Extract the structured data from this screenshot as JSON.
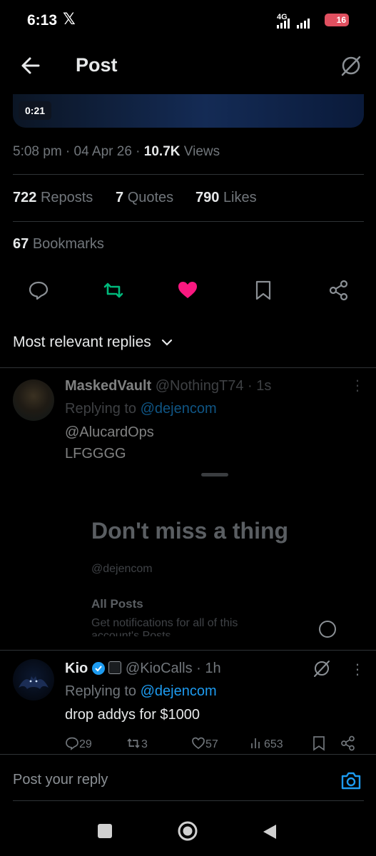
{
  "status_bar": {
    "time": "6:13",
    "network": "4G",
    "battery": "16"
  },
  "header": {
    "title": "Post"
  },
  "video": {
    "duration": "0:21"
  },
  "post_meta": {
    "time": "5:08 pm",
    "date": "04 Apr 26",
    "views_count": "10.7K",
    "views_label": "Views"
  },
  "stats": {
    "reposts_count": "722",
    "reposts_label": "Reposts",
    "quotes_count": "7",
    "quotes_label": "Quotes",
    "likes_count": "790",
    "likes_label": "Likes",
    "bookmarks_count": "67",
    "bookmarks_label": "Bookmarks"
  },
  "actions": [
    "reply-icon",
    "repost-icon",
    "like-icon",
    "bookmark-icon",
    "share-icon"
  ],
  "replies_filter": {
    "label": "Most relevant replies"
  },
  "reply1": {
    "name": "MaskedVault",
    "handle": "@NothingT74",
    "time": "1s",
    "replying_prefix": "Replying to",
    "replying_to": "@dejencom",
    "line1": "@AlucardOps",
    "line2": "LFGGGG"
  },
  "notify_sheet": {
    "title": "Don't miss a thing",
    "handle": "@dejencom",
    "option_title": "All Posts",
    "option_desc": "Get notifications for all of this",
    "option_desc_cut": "account's Posts"
  },
  "reply2": {
    "name": "Kio",
    "handle": "@KioCalls",
    "time": "1h",
    "replying_prefix": "Replying to",
    "replying_to": "@dejencom",
    "text": "drop addys for $1000",
    "replies": "29",
    "reposts": "3",
    "likes": "57",
    "views": "653"
  },
  "composer": {
    "placeholder": "Post your reply"
  },
  "colors": {
    "accent": "#1d9bf0",
    "like": "#f91880",
    "repost": "#00ba7c",
    "bg": "#000000"
  }
}
